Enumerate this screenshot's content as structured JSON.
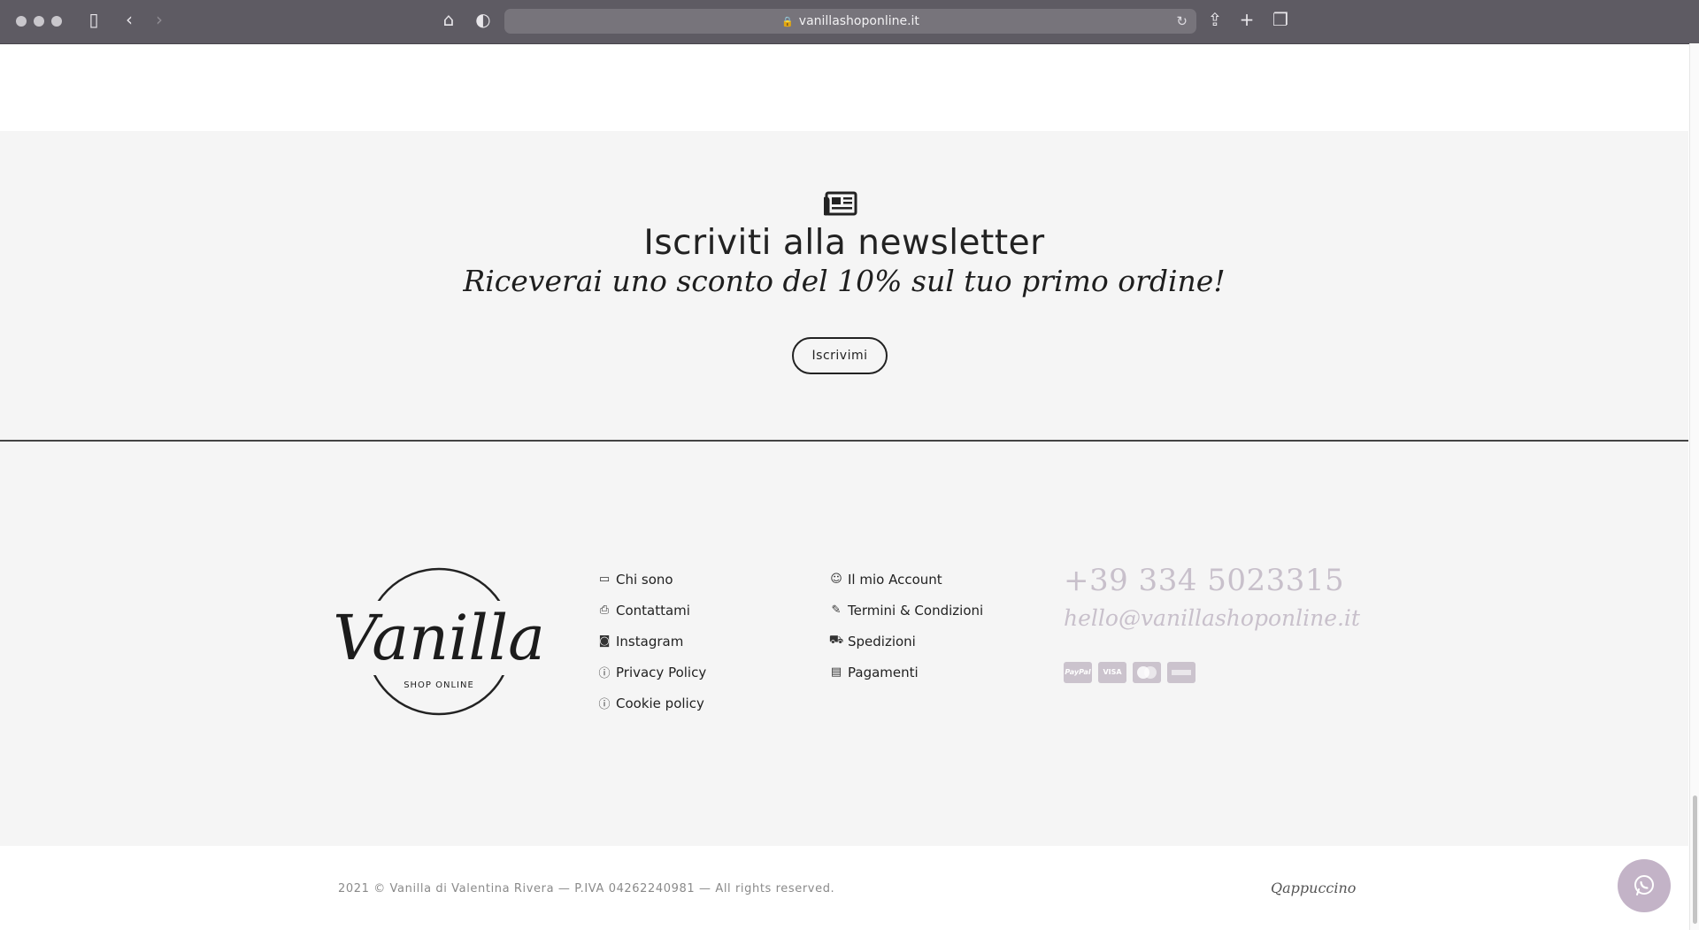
{
  "browser": {
    "url": "vanillashoponline.it"
  },
  "newsletter": {
    "title": "Iscriviti alla newsletter",
    "subtitle": "Riceverai uno sconto del 10% sul tuo primo ordine!",
    "button_label": "Iscrivimi"
  },
  "logo": {
    "brand": "Vanilla",
    "tagline": "SHOP ONLINE"
  },
  "footer": {
    "links_col1": [
      {
        "label": "Chi sono",
        "icon": "store-icon"
      },
      {
        "label": "Contattami",
        "icon": "printer-icon"
      },
      {
        "label": "Instagram",
        "icon": "camera-icon"
      },
      {
        "label": "Privacy Policy",
        "icon": "info-icon"
      },
      {
        "label": "Cookie policy",
        "icon": "info-icon"
      }
    ],
    "links_col2": [
      {
        "label": "Il mio Account",
        "icon": "user-icon"
      },
      {
        "label": "Termini & Condizioni",
        "icon": "edit-icon"
      },
      {
        "label": "Spedizioni",
        "icon": "truck-icon"
      },
      {
        "label": "Pagamenti",
        "icon": "cash-register-icon"
      }
    ],
    "phone": "+39 334 5023315",
    "email": "hello@vanillashoponline.it",
    "payment_methods": [
      "PayPal",
      "VISA",
      "",
      ""
    ],
    "payment_icons": [
      "paypal-icon",
      "visa-icon",
      "mastercard-icon",
      "amex-icon"
    ]
  },
  "bottom": {
    "copyright": "2021 © Vanilla di Valentina Rivera — P.IVA 04262240981 — All rights reserved.",
    "credit": "Qappuccino"
  },
  "colors": {
    "accent": "#c3b3c7",
    "footer_bg": "#f5f5f5",
    "muted_text": "#c8c0cb"
  }
}
